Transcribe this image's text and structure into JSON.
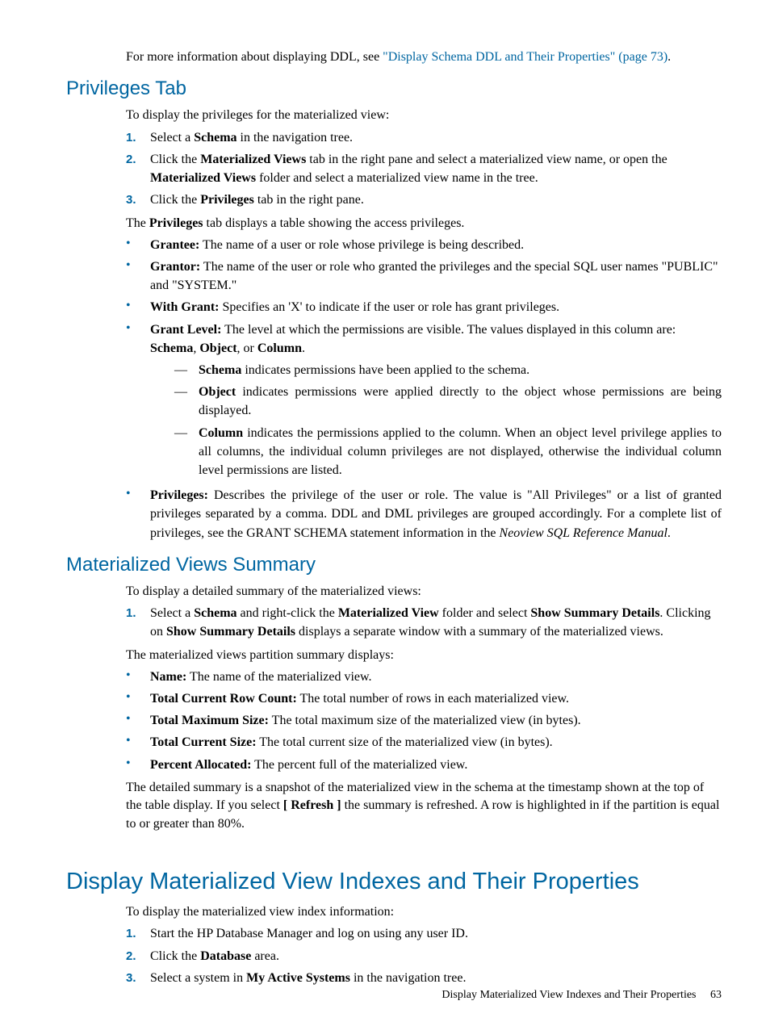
{
  "intro_pre": "For more information about displaying DDL, see ",
  "intro_link": "\"Display Schema DDL and Their Properties\" (page 73)",
  "intro_post": ".",
  "priv": {
    "heading": "Privileges Tab",
    "lead": "To display the privileges for the materialized view:",
    "steps": {
      "s1": "Select a ",
      "s1b": "Schema",
      "s1c": " in the navigation tree.",
      "s2a": "Click the ",
      "s2b": "Materialized Views",
      "s2c": " tab in the right pane and select a materialized view name, or open the ",
      "s2d": "Materialized Views",
      "s2e": " folder and select a materialized view name in the tree.",
      "s3a": "Click the ",
      "s3b": "Privileges",
      "s3c": " tab in the right pane."
    },
    "tab_line_a": "The ",
    "tab_line_b": "Privileges",
    "tab_line_c": " tab displays a table showing the access privileges.",
    "b1a": "Grantee:",
    "b1b": " The name of a user or role whose privilege is being described.",
    "b2a": "Grantor:",
    "b2b": " The name of the user or role who granted the privileges and the special SQL user names \"PUBLIC\" and \"SYSTEM.\"",
    "b3a": "With Grant:",
    "b3b": " Specifies an 'X' to indicate if the user or role has grant privileges.",
    "b4a": "Grant Level:",
    "b4b": " The level at which the permissions are visible. The values displayed in this column are: ",
    "b4s": "Schema",
    "b4c": ", ",
    "b4o": "Object",
    "b4d": ", or ",
    "b4col": "Column",
    "b4e": ".",
    "d1a": "Schema",
    "d1b": " indicates permissions have been applied to the schema.",
    "d2a": "Object",
    "d2b": " indicates permissions were applied directly to the object whose permissions are being displayed.",
    "d3a": "Column",
    "d3b": " indicates the permissions applied to the column. When an object level privilege applies to all columns, the individual column privileges are not displayed, otherwise the individual column level permissions are listed.",
    "b5a": "Privileges:",
    "b5b": " Describes the privilege of the user or role. The value is \"All Privileges\" or a list of granted privileges separated by a comma. DDL and DML privileges are grouped accordingly. For a complete list of privileges, see the GRANT SCHEMA statement information in the ",
    "b5i": "Neoview SQL Reference Manual",
    "b5c": "."
  },
  "mvs": {
    "heading": "Materialized Views Summary",
    "lead": "To display a detailed summary of the materialized views:",
    "s1a": "Select a ",
    "s1b": "Schema",
    "s1c": " and right-click the ",
    "s1d": "Materialized View",
    "s1e": " folder and select ",
    "s1f": "Show Summary Details",
    "s1g": ". Clicking on ",
    "s1h": "Show Summary Details",
    "s1i": " displays a separate window with a summary of the materialized views.",
    "disp": "The materialized views partition summary displays:",
    "b1a": "Name:",
    "b1b": " The name of the materialized view.",
    "b2a": "Total Current Row Count:",
    "b2b": " The total number of rows in each materialized view.",
    "b3a": "Total Maximum Size:",
    "b3b": " The total maximum size of the materialized view (in bytes).",
    "b4a": "Total Current Size:",
    "b4b": " The total current size of the materialized view (in bytes).",
    "b5a": "Percent Allocated:",
    "b5b": " The percent full of the materialized view.",
    "tail_a": "The detailed summary is a snapshot of the materialized view in the schema at the timestamp shown at the top of the table display. If you select ",
    "tail_b": "[ Refresh ]",
    "tail_c": " the summary is refreshed. A row is highlighted in if the partition is equal to or greater than 80%."
  },
  "idx": {
    "heading": "Display Materialized View Indexes and Their Properties",
    "lead": "To display the materialized view index information:",
    "s1": "Start the HP Database Manager and log on using any user ID.",
    "s2a": "Click the ",
    "s2b": "Database",
    "s2c": " area.",
    "s3a": "Select a system in ",
    "s3b": "My Active Systems",
    "s3c": " in the navigation tree."
  },
  "footer_text": "Display Materialized View Indexes and Their Properties",
  "footer_page": "63",
  "nums": {
    "n1": "1.",
    "n2": "2.",
    "n3": "3."
  },
  "bullet": "•",
  "dash": "—"
}
